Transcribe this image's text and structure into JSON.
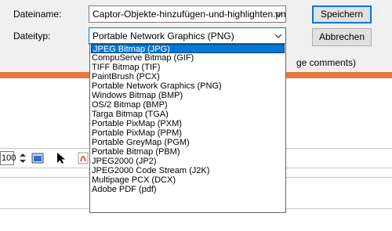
{
  "dialog": {
    "filename_label": "Dateiname:",
    "filename_value": "Captor-Objekte-hinzufügen-und-highlighten.png",
    "filetype_label": "Dateityp:",
    "filetype_value": "Portable Network Graphics (PNG)",
    "save_button": "Speichern",
    "cancel_button": "Abbrechen"
  },
  "background": {
    "partial_text": "ge comments)",
    "zoom_value": "100"
  },
  "filetype_options": [
    "JPEG Bitmap (JPG)",
    "CompuServe Bitmap (GIF)",
    "TIFF Bitmap (TIF)",
    "PaintBrush (PCX)",
    "Portable Network Graphics (PNG)",
    "Windows Bitmap (BMP)",
    "OS/2 Bitmap (BMP)",
    "Targa Bitmap (TGA)",
    "Portable PixMap (PXM)",
    "Portable PixMap (PPM)",
    "Portable GreyMap (PGM)",
    "Portable Bitmap (PBM)",
    "JPEG2000 (JP2)",
    "JPEG2000 Code Stream (J2K)",
    "Multipage PCX (DCX)",
    "Adobe PDF (pdf)"
  ],
  "selected_option": "JPEG Bitmap (JPG)",
  "colors": {
    "accent": "#e8793c",
    "selection": "#0078d7",
    "dialog_bg": "#f0f0f0"
  }
}
